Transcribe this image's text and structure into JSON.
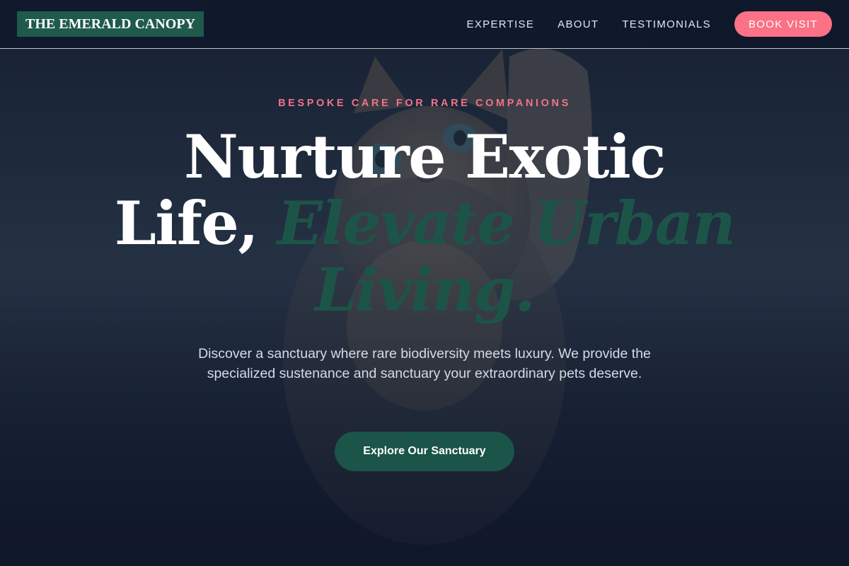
{
  "brand": {
    "name": "THE EMERALD CANOPY"
  },
  "nav": {
    "links": [
      "EXPERTISE",
      "ABOUT",
      "TESTIMONIALS"
    ],
    "book_label": "BOOK VISIT"
  },
  "hero": {
    "eyebrow": "BESPOKE CARE FOR RARE COMPANIONS",
    "headline_plain": "Nurture Exotic Life,",
    "headline_accent": "Elevate Urban Living.",
    "subtitle": "Discover a sanctuary where rare biodiversity meets luxury. We provide the specialized sustenance and sanctuary your extraordinary pets deserve.",
    "cta_label": "Explore Our Sanctuary"
  },
  "colors": {
    "background": "#0f172a",
    "accent_green": "#1b5448",
    "accent_pink": "#fb7185",
    "eyebrow": "#f17388"
  }
}
